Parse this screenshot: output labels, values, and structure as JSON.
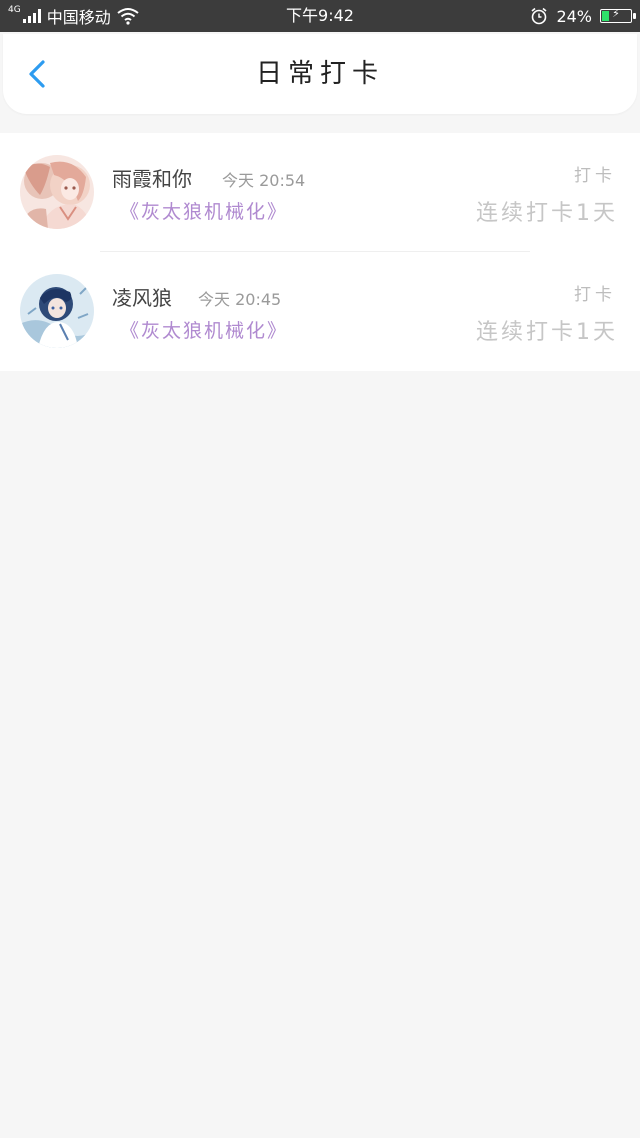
{
  "status_bar": {
    "network": "4G",
    "carrier": "中国移动",
    "time": "下午9:42",
    "battery": "24%",
    "battery_level": 0.24,
    "icons": [
      "signal-icon",
      "wifi-icon",
      "alarm-icon",
      "battery-icon",
      "charging-icon"
    ]
  },
  "header": {
    "title": "日常打卡",
    "back_icon": "chevron-left-icon",
    "accent": "#2d9cf0"
  },
  "checkins": [
    {
      "name": "雨霞和你",
      "time": "今天 20:54",
      "group": "《灰太狼机械化》",
      "kind": "打卡",
      "streak": "连续打卡1天"
    },
    {
      "name": "凌风狼",
      "time": "今天 20:45",
      "group": "《灰太狼机械化》",
      "kind": "打卡",
      "streak": "连续打卡1天"
    }
  ],
  "colors": {
    "status_bar_bg": "#3c3c3c",
    "page_bg": "#f6f6f6",
    "group_text": "#b08ad0",
    "battery_fill": "#2ee06a"
  }
}
